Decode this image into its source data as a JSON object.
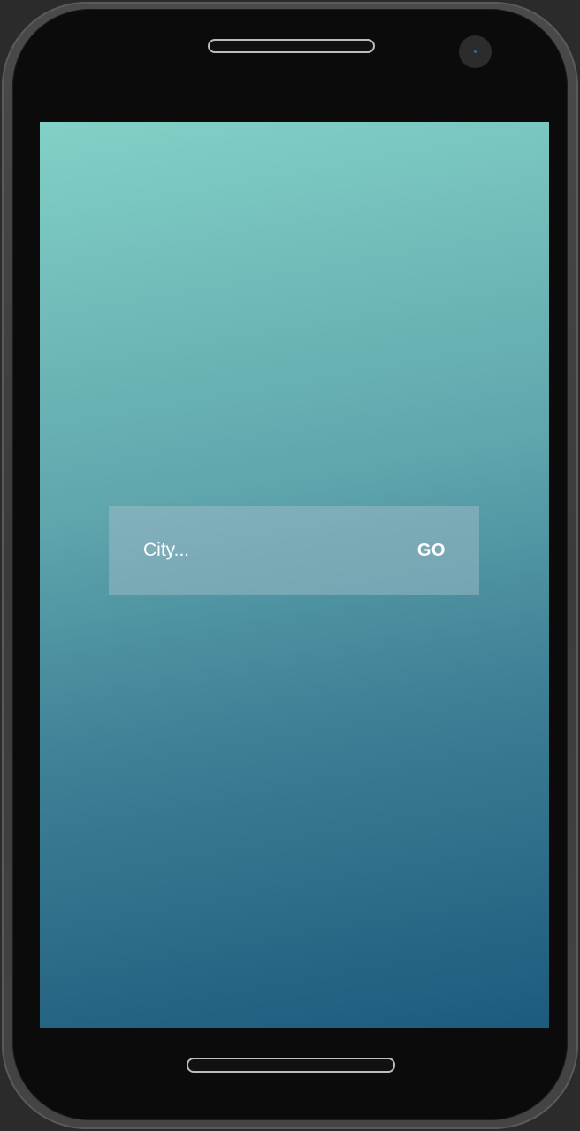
{
  "search": {
    "placeholder": "City...",
    "value": "",
    "go_label": "GO"
  },
  "colors": {
    "gradient_top": "#82d0c6",
    "gradient_bottom": "#1c5b7d",
    "text": "#ffffff"
  }
}
